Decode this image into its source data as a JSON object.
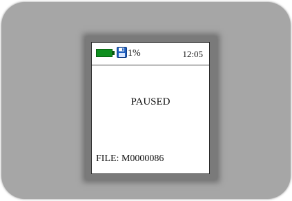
{
  "status_bar": {
    "battery_icon": "battery-icon",
    "battery_color": "#0f8f1f",
    "save_icon": "floppy-disk-icon",
    "save_icon_color": "#1f5fbf",
    "battery_percent": "1%",
    "time": "12:05"
  },
  "main": {
    "status_message": "PAUSED"
  },
  "footer": {
    "file_label": "FILE: M0000086"
  }
}
